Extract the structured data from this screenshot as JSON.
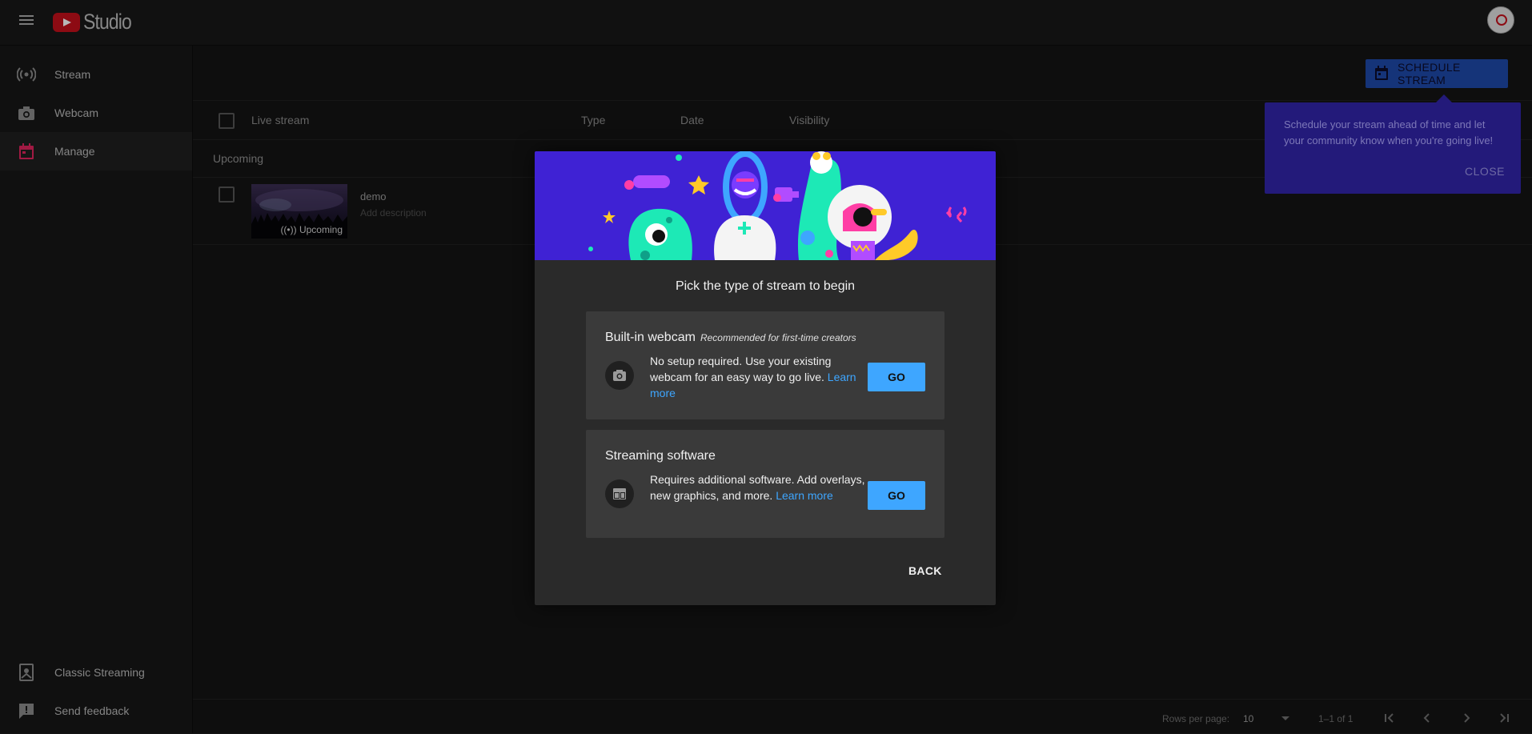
{
  "app": {
    "logo_text": "Studio"
  },
  "sidebar": {
    "items": [
      {
        "label": "Stream",
        "icon": "broadcast-icon"
      },
      {
        "label": "Webcam",
        "icon": "camera-icon"
      },
      {
        "label": "Manage",
        "icon": "calendar-icon",
        "active": true
      }
    ],
    "bottom_items": [
      {
        "label": "Classic Streaming",
        "icon": "classic-streaming-icon"
      },
      {
        "label": "Send feedback",
        "icon": "feedback-icon"
      }
    ]
  },
  "toolbar": {
    "schedule_label": "SCHEDULE STREAM"
  },
  "table": {
    "columns": [
      "Live stream",
      "Type",
      "Date",
      "Visibility"
    ],
    "section": "Upcoming",
    "rows": [
      {
        "title": "demo",
        "description": "Add description",
        "badge": "Upcoming"
      }
    ]
  },
  "footer": {
    "rows_per_page_label": "Rows per page:",
    "rows_per_page_value": "10",
    "range": "1–1 of 1"
  },
  "tooltip": {
    "text": "Schedule your stream ahead of time and let your community know when you're going live!",
    "close_label": "CLOSE"
  },
  "dialog": {
    "title": "Pick the type of stream to begin",
    "options": [
      {
        "title": "Built-in webcam",
        "subtitle": "Recommended for first-time creators",
        "description": "No setup required. Use your existing webcam for an easy way to go live.",
        "learn_more": "Learn more",
        "go_label": "GO",
        "icon": "camera-icon"
      },
      {
        "title": "Streaming software",
        "subtitle": "",
        "description": "Requires additional software. Add overlays, new graphics, and more.",
        "learn_more": "Learn more",
        "go_label": "GO",
        "icon": "window-layout-icon"
      }
    ],
    "back_label": "BACK"
  },
  "colors": {
    "accent_blue": "#3ea6ff",
    "brand_red": "#c4101b",
    "manage_active": "#e0245e",
    "tooltip_bg": "#231a7a",
    "banner_bg": "#3f22d4"
  }
}
